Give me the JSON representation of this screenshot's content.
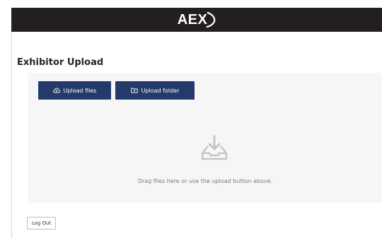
{
  "header": {
    "logo_text": "AEX"
  },
  "page": {
    "title": "Exhibitor Upload"
  },
  "toolbar": {
    "upload_files_label": "Upload files",
    "upload_folder_label": "Upload folder"
  },
  "dropzone": {
    "hint": "Drag files here or use the upload button above."
  },
  "footer": {
    "logout_label": "Log Out"
  },
  "colors": {
    "header_bg": "#231f20",
    "button_bg": "#233a6b",
    "panel_bg": "#f6f6f6"
  },
  "icons": {
    "upload_files": "cloud-upload-icon",
    "upload_folder": "folder-upload-icon",
    "dropzone": "download-tray-icon",
    "logo_mark": "arc-swoosh-icon"
  }
}
